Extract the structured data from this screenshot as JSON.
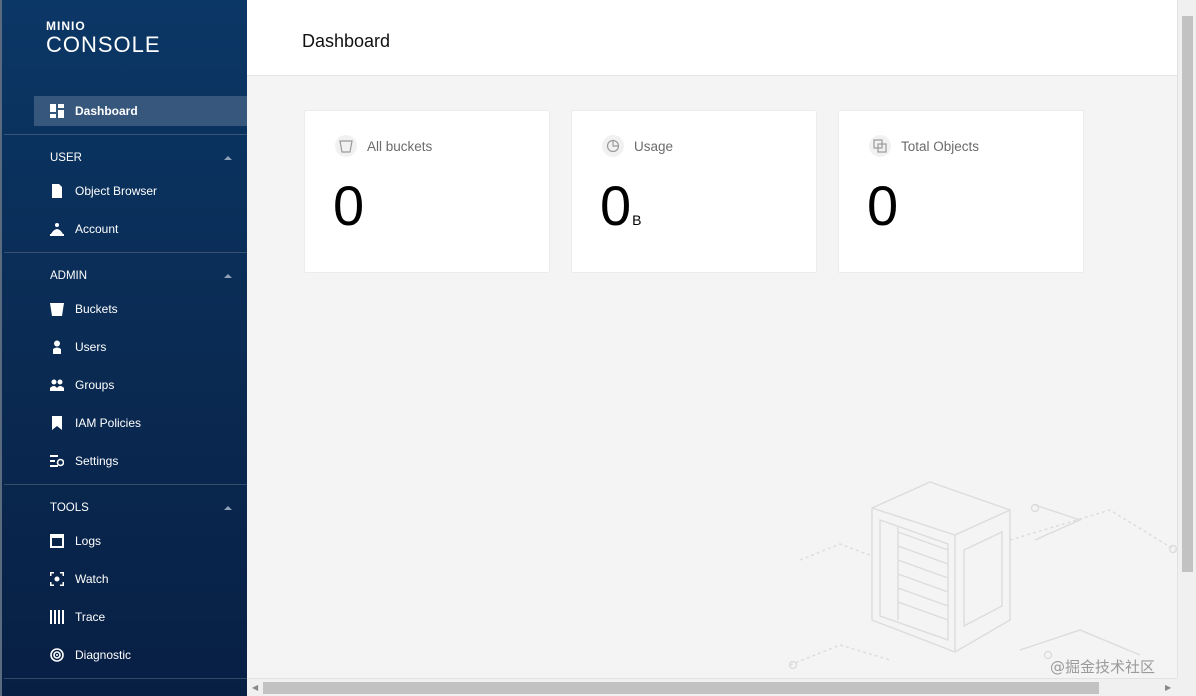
{
  "logo": {
    "top": "MINIO",
    "main": "CONSOLE"
  },
  "sidebar": {
    "dashboard": "Dashboard",
    "sections": [
      {
        "title": "USER",
        "items": [
          "Object Browser",
          "Account"
        ]
      },
      {
        "title": "ADMIN",
        "items": [
          "Buckets",
          "Users",
          "Groups",
          "IAM Policies",
          "Settings"
        ]
      },
      {
        "title": "TOOLS",
        "items": [
          "Logs",
          "Watch",
          "Trace",
          "Diagnostic"
        ]
      }
    ]
  },
  "header": {
    "title": "Dashboard"
  },
  "cards": [
    {
      "label": "All buckets",
      "value": "0",
      "unit": "",
      "icon": "bucket-icon"
    },
    {
      "label": "Usage",
      "value": "0",
      "unit": "B",
      "icon": "pie-chart-icon"
    },
    {
      "label": "Total Objects",
      "value": "0",
      "unit": "",
      "icon": "objects-icon"
    }
  ],
  "watermark": "@掘金技术社区",
  "colors": {
    "sidebar": "#0b3766",
    "background": "#f4f4f4"
  }
}
